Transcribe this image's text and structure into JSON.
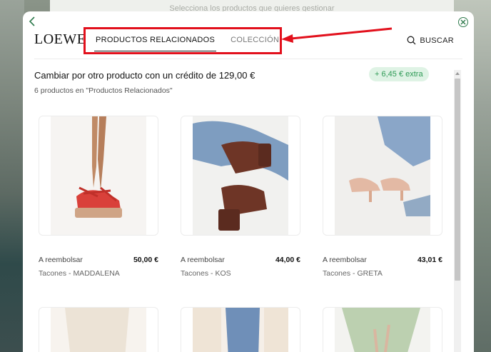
{
  "background": {
    "top_text": "Selecciona los productos que quieres gestionar"
  },
  "header": {
    "back_icon": "chevron-left-icon",
    "close_icon": "close-circle-icon",
    "logo": "LOEWE",
    "tabs": [
      {
        "label": "PRODUCTOS RELACIONADOS",
        "active": true
      },
      {
        "label": "COLECCIÓN",
        "active": false
      }
    ],
    "search_label": "BUSCAR",
    "search_icon": "search-icon"
  },
  "content": {
    "credit_title": "Cambiar por otro producto con un crédito de 129,00 €",
    "extra_badge": "+ 6,45 € extra",
    "count_text": "6 productos en \"Productos Relacionados\"",
    "products": [
      {
        "status": "A reembolsar",
        "price": "50,00 €",
        "name": "Tacones - MADDALENA"
      },
      {
        "status": "A reembolsar",
        "price": "44,00 €",
        "name": "Tacones - KOS"
      },
      {
        "status": "A reembolsar",
        "price": "43,01 €",
        "name": "Tacones - GRETA"
      }
    ]
  },
  "colors": {
    "accent": "#2e7a4c",
    "badge_bg": "#dff3e5",
    "badge_text": "#2e9a55",
    "annotation": "#e2101c"
  }
}
